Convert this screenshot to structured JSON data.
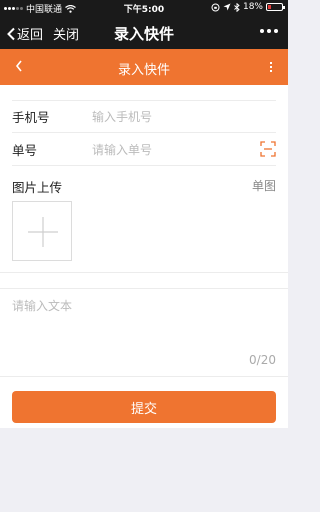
{
  "status_bar": {
    "carrier": "中国联通",
    "time": "下午5:00",
    "battery": "18%",
    "battery_level": 0.18
  },
  "wx_nav": {
    "back_label": "返回",
    "close_label": "关闭",
    "title": "录入快件"
  },
  "header": {
    "title": "录入快件"
  },
  "form": {
    "phone": {
      "label": "手机号",
      "placeholder": "输入手机号"
    },
    "order": {
      "label": "单号",
      "placeholder": "请输入单号"
    },
    "upload": {
      "label": "图片上传",
      "mode": "单图"
    },
    "text": {
      "placeholder": "请输入文本",
      "counter": "0/20"
    },
    "submit_label": "提交"
  },
  "colors": {
    "accent": "#ef7430",
    "nav_bg": "#1a1a1a"
  }
}
